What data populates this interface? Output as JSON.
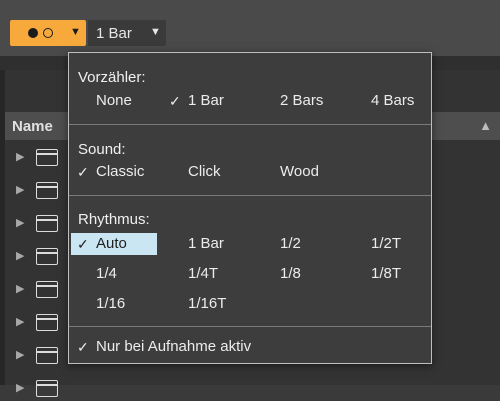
{
  "toolbar": {
    "metronome_icon": "metronome-dots-icon",
    "bar_select_value": "1 Bar"
  },
  "browser": {
    "column_name": "Name",
    "row_count": 8
  },
  "menu": {
    "count_in": {
      "title": "Vorzähler:",
      "options": [
        {
          "label": "None",
          "checked": false
        },
        {
          "label": "1 Bar",
          "checked": true
        },
        {
          "label": "2 Bars",
          "checked": false
        },
        {
          "label": "4 Bars",
          "checked": false
        }
      ]
    },
    "sound": {
      "title": "Sound:",
      "options": [
        {
          "label": "Classic",
          "checked": true
        },
        {
          "label": "Click",
          "checked": false
        },
        {
          "label": "Wood",
          "checked": false
        }
      ]
    },
    "rhythm": {
      "title": "Rhythmus:",
      "options": [
        {
          "label": "Auto",
          "checked": true,
          "highlighted": true
        },
        {
          "label": "1 Bar",
          "checked": false
        },
        {
          "label": "1/2",
          "checked": false
        },
        {
          "label": "1/2T",
          "checked": false
        },
        {
          "label": "1/4",
          "checked": false
        },
        {
          "label": "1/4T",
          "checked": false
        },
        {
          "label": "1/8",
          "checked": false
        },
        {
          "label": "1/8T",
          "checked": false
        },
        {
          "label": "1/16",
          "checked": false
        },
        {
          "label": "1/16T",
          "checked": false
        }
      ]
    },
    "record_only": {
      "label": "Nur bei Aufnahme aktiv",
      "checked": true
    }
  },
  "colors": {
    "accent": "#f7a93c",
    "highlight": "#cbe6f3",
    "menu_bg": "#3d3d3d"
  }
}
